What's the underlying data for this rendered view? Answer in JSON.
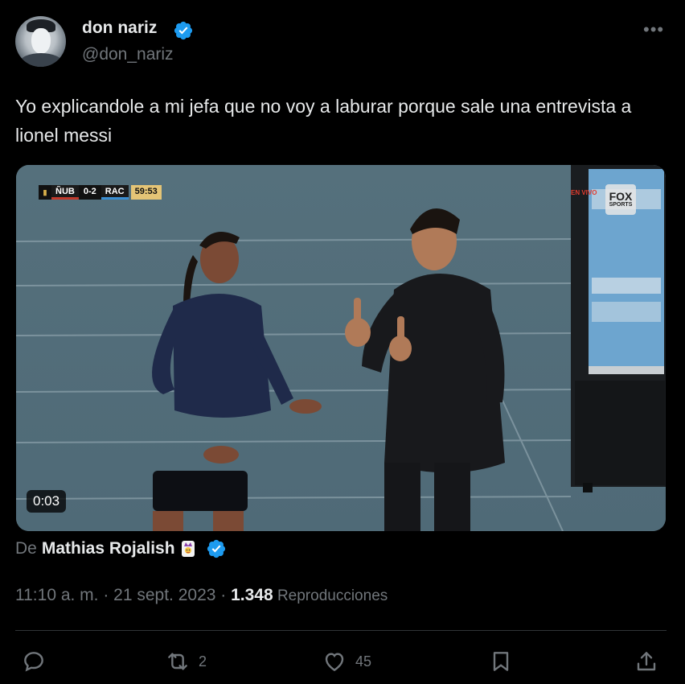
{
  "tweet": {
    "author_name": "don nariz",
    "author_handle": "@don_nariz",
    "more_label": "•••",
    "text": "Yo explicandole a mi jefa que no voy a laburar porque sale una entrevista a lionel messi",
    "timestamp": "11:10 a. m. · 21 sept. 2023 · ",
    "views": "1.348",
    "views_label": " Reproducciones"
  },
  "media": {
    "duration": "0:03",
    "scoreboard": {
      "team1": "ÑUB",
      "score": "0-2",
      "team2": "RAC",
      "clock": "59:53"
    },
    "live_label": "EN VIVO",
    "broadcaster_line1": "FOX",
    "broadcaster_line2": "SPORTS"
  },
  "attribution": {
    "prefix": "De",
    "author": "Mathias Rojalish"
  },
  "actions": {
    "reply_count": "",
    "retweet_count": "2",
    "like_count": "45",
    "bookmark_count": "",
    "share_count": ""
  },
  "icons": [
    "verified-badge-icon",
    "more-icon",
    "reply-icon",
    "retweet-icon",
    "like-icon",
    "bookmark-icon",
    "share-icon",
    "joker-emoji-icon"
  ],
  "colors": {
    "background": "#000000",
    "text_primary": "#e7e9ea",
    "text_secondary": "#71767b",
    "verified_blue": "#1d9bf0",
    "divider": "#2f3336"
  }
}
